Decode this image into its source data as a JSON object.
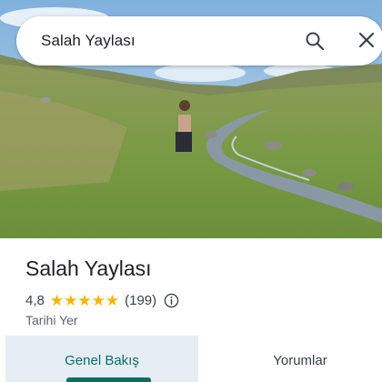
{
  "search": {
    "query": "Salah Yaylası",
    "search_icon": "search-icon",
    "close_icon": "close-icon"
  },
  "place": {
    "name": "Salah Yaylası",
    "rating": "4,8",
    "stars": 5,
    "review_count": "(199)",
    "category": "Tarihi Yer"
  },
  "tabs": [
    {
      "label": "Genel Bakış",
      "selected": true
    },
    {
      "label": "Yorumlar",
      "selected": false
    }
  ],
  "colors": {
    "accent": "#0b6e63",
    "star": "#f4b400",
    "selected_tab_bg": "#e6eef3"
  }
}
